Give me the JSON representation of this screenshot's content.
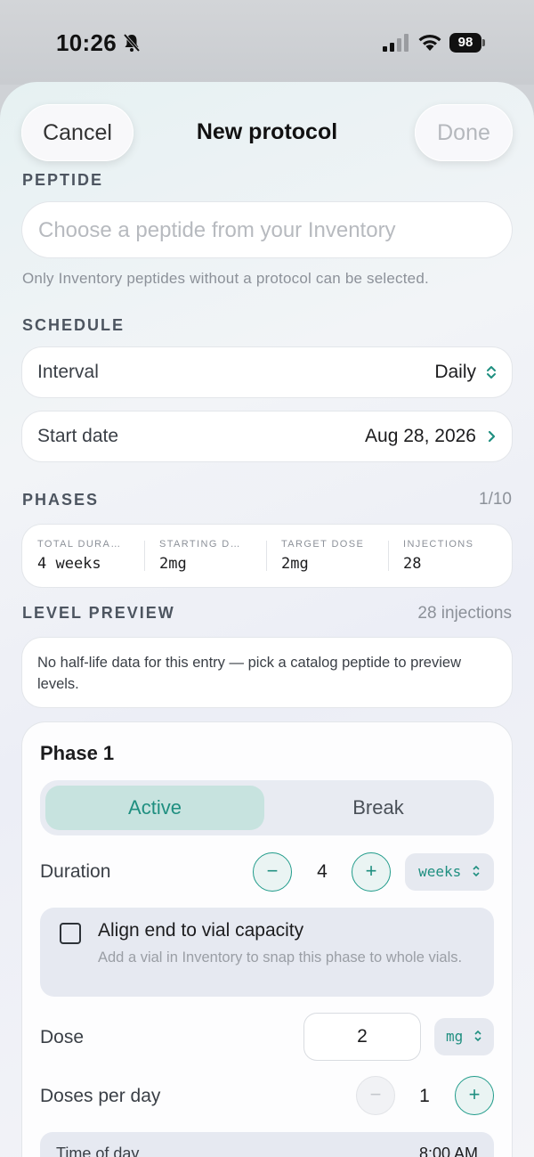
{
  "status_bar": {
    "time": "10:26",
    "battery": "98"
  },
  "nav": {
    "cancel": "Cancel",
    "title": "New protocol",
    "done": "Done"
  },
  "peptide": {
    "section_label": "PEPTIDE",
    "placeholder": "Choose a peptide from your Inventory",
    "hint": "Only Inventory peptides without a protocol can be selected."
  },
  "schedule": {
    "section_label": "SCHEDULE",
    "interval": {
      "label": "Interval",
      "value": "Daily"
    },
    "start_date": {
      "label": "Start date",
      "value": "Aug 28, 2026"
    }
  },
  "phases": {
    "section_label": "PHASES",
    "count": "1/10",
    "stats": [
      {
        "label": "TOTAL DURA…",
        "value": "4 weeks"
      },
      {
        "label": "STARTING D…",
        "value": "2mg"
      },
      {
        "label": "TARGET DOSE",
        "value": "2mg"
      },
      {
        "label": "INJECTIONS",
        "value": "28"
      }
    ]
  },
  "level_preview": {
    "section_label": "LEVEL PREVIEW",
    "count": "28 injections",
    "note": "No half-life data for this entry — pick a catalog peptide to preview levels."
  },
  "phase1": {
    "title": "Phase 1",
    "mode": {
      "active": "Active",
      "break": "Break",
      "selected": "Active"
    },
    "duration": {
      "label": "Duration",
      "minus": "−",
      "value": "4",
      "plus": "+",
      "unit": "weeks"
    },
    "align": {
      "title": "Align end to vial capacity",
      "subtitle": "Add a vial in Inventory to snap this phase to whole vials.",
      "checked": false
    },
    "dose": {
      "label": "Dose",
      "value": "2",
      "unit": "mg"
    },
    "doses_per_day": {
      "label": "Doses per day",
      "minus": "−",
      "value": "1",
      "plus": "+"
    },
    "time_of_day": {
      "label": "Time of day",
      "value": "8:00 AM"
    }
  },
  "colors": {
    "accent": "#1f8f80",
    "active_segment": "#c7e3df"
  },
  "icons": [
    "bell-slash-icon",
    "signal-icon",
    "wifi-icon",
    "battery-icon",
    "chevron-up-down-icon",
    "chevron-right-icon",
    "checkbox-icon"
  ]
}
